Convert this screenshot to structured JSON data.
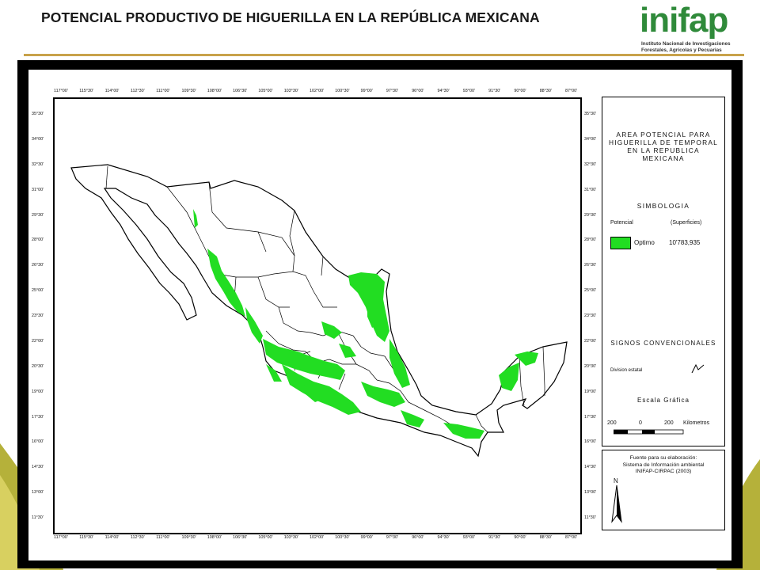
{
  "slide": {
    "title": "POTENCIAL PRODUCTIVO DE HIGUERILLA EN LA REPÚBLICA MEXICANA"
  },
  "logo": {
    "word": "inifap",
    "line1": "Instituto Nacional de Investigaciones",
    "line2": "Forestales, Agrícolas y Pecuarias"
  },
  "colors": {
    "potential_green": "#22dd22",
    "border_black": "#000000",
    "rule_gold": "#c8a24a",
    "olive_swoosh": "#b5b13a"
  },
  "map": {
    "top_ticks": [
      "117°00'",
      "115°30'",
      "114°00'",
      "112°30'",
      "111°00'",
      "109°30'",
      "108°00'",
      "106°30'",
      "105°00'",
      "103°30'",
      "102°00'",
      "100°30'",
      "99°00'",
      "97°30'",
      "96°00'",
      "94°30'",
      "93°00'",
      "91°30'",
      "90°00'",
      "88°30'",
      "87°00'"
    ],
    "left_ticks": [
      "35°30'",
      "34°00'",
      "32°30'",
      "31°00'",
      "29°30'",
      "28°00'",
      "26°30'",
      "25°00'",
      "23°30'",
      "22°00'",
      "20°30'",
      "19°00'",
      "17°30'",
      "16°00'",
      "14°30'",
      "13°00'",
      "11°30'"
    ],
    "right_ticks": [
      "35°30'",
      "34°00'",
      "32°30'",
      "31°00'",
      "29°30'",
      "28°00'",
      "26°30'",
      "25°00'",
      "23°30'",
      "22°00'",
      "20°30'",
      "19°00'",
      "17°30'",
      "16°00'",
      "14°30'",
      "13°00'",
      "11°30'"
    ]
  },
  "legend": {
    "title_lines": [
      "AREA POTENCIAL PARA",
      "HIGUERILLA DE TEMPORAL",
      "EN LA REPUBLICA",
      "MEXICANA"
    ],
    "simbologia": "SIMBOLOGIA",
    "col_potential": "Potencial",
    "col_area": "(Superficies)",
    "class_label": "Optimo",
    "class_value": "10'783,935",
    "signos": "SIGNOS CONVENCIONALES",
    "division_label": "Division estatal",
    "escala": "Escala Gráfica",
    "scale_left": "200",
    "scale_mid": "0",
    "scale_right": "200",
    "scale_unit": "Kilometros",
    "fuente_lines": [
      "Fuente para su elaboración:",
      "Sistema de Información ambiental",
      "INIFAP-CIRPAC (2003)"
    ],
    "north": "N"
  }
}
